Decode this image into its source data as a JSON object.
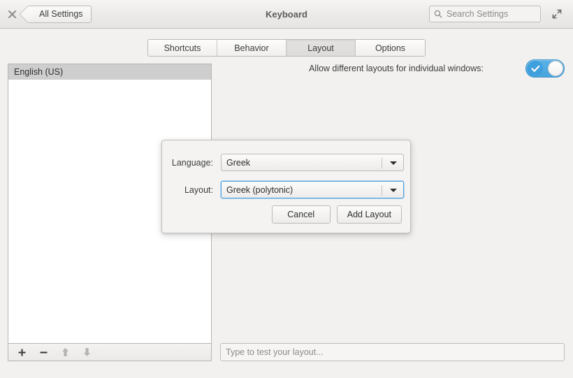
{
  "titlebar": {
    "close_icon": "close-icon",
    "back_label": "All Settings",
    "title": "Keyboard",
    "search_icon": "search-icon",
    "search_placeholder": "Search Settings",
    "maximize_icon": "maximize-icon"
  },
  "tabs": [
    {
      "label": "Shortcuts",
      "active": false
    },
    {
      "label": "Behavior",
      "active": false
    },
    {
      "label": "Layout",
      "active": true
    },
    {
      "label": "Options",
      "active": false
    }
  ],
  "layout_panel": {
    "items": [
      {
        "label": "English (US)",
        "selected": true
      }
    ],
    "toolbar": {
      "add": "+",
      "remove": "−",
      "move_up": "⬆",
      "move_down": "⬇"
    }
  },
  "options": {
    "allow_different_layouts_label": "Allow different layouts for individual windows:",
    "allow_different_layouts_value": "on",
    "toggle_color": "#4ba5dd"
  },
  "test_field": {
    "placeholder": "Type to test your layout...",
    "value": ""
  },
  "dialog": {
    "language_label": "Language:",
    "language_value": "Greek",
    "layout_label": "Layout:",
    "layout_value": "Greek (polytonic)",
    "cancel_label": "Cancel",
    "add_label": "Add Layout",
    "focus_color": "#4a9fe0"
  }
}
